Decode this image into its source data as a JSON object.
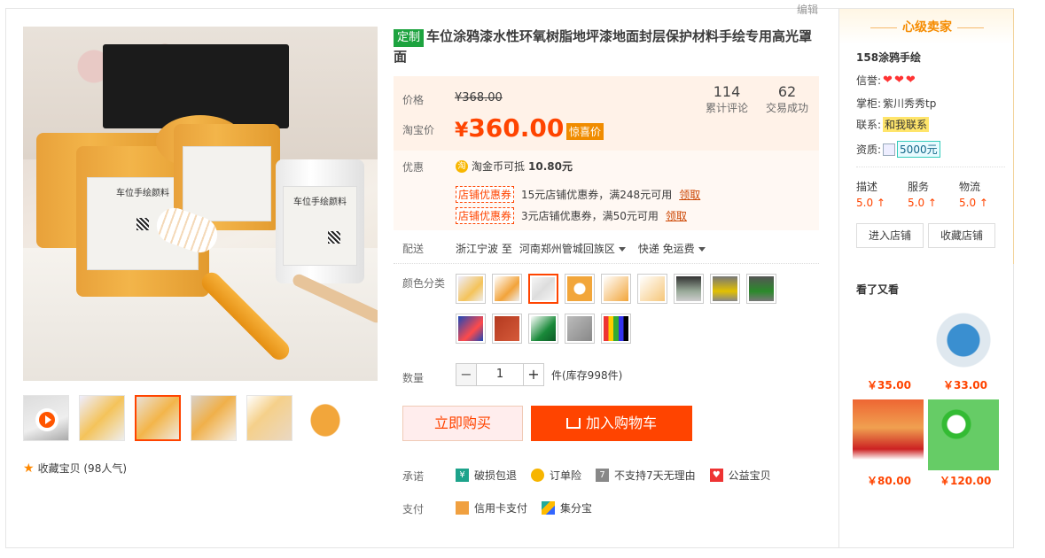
{
  "edit_link": "编辑",
  "product": {
    "tag": "定制",
    "title": "车位涂鸦漆水性环氧树脂地坪漆地面封层保护材料手绘专用高光罩面"
  },
  "gallery": {
    "jar_label": "车位手绘颜料",
    "favorite": "收藏宝贝 (98人气)"
  },
  "price": {
    "label": "价格",
    "original": "¥368.00",
    "taobao_label": "淘宝价",
    "currency": "¥",
    "current": "360.00",
    "surprise_tag": "惊喜价",
    "stats": [
      {
        "value": "114",
        "label": "累计评论"
      },
      {
        "value": "62",
        "label": "交易成功"
      }
    ]
  },
  "promo": {
    "label": "优惠",
    "coin_icon_text": "淘",
    "coin_text_prefix": "淘金币可抵",
    "coin_amount": "10.80元",
    "coupons": [
      {
        "tag": "店铺优惠券",
        "desc": "15元店铺优惠券，满248元可用",
        "action": "领取"
      },
      {
        "tag": "店铺优惠券",
        "desc": "3元店铺优惠券，满50元可用",
        "action": "领取"
      }
    ]
  },
  "shipping": {
    "label": "配送",
    "from": "浙江宁波 至",
    "to": "河南郑州管城回族区",
    "method": "快递 免运费"
  },
  "color": {
    "label": "颜色分类"
  },
  "quantity": {
    "label": "数量",
    "minus": "−",
    "plus": "+",
    "value": "1",
    "stock": "件(库存998件)"
  },
  "buttons": {
    "buy_now": "立即购买",
    "add_cart": "加入购物车"
  },
  "promise": {
    "label": "承诺",
    "items": [
      {
        "icon_text": "¥",
        "text": "破损包退",
        "color": "#1da38b"
      },
      {
        "icon_text": "",
        "text": "订单险",
        "color": "#f7b500"
      },
      {
        "icon_text": "7",
        "text": "不支持7天无理由",
        "color": "#888888"
      },
      {
        "icon_text": "♥",
        "text": "公益宝贝",
        "color": "#e33"
      }
    ]
  },
  "payment": {
    "label": "支付",
    "items": [
      "信用卡支付",
      "集分宝"
    ]
  },
  "seller": {
    "header": "心级卖家",
    "shop_name": "158涂鸦手绘",
    "credit_label": "信誉:",
    "keeper_label": "掌柜:",
    "keeper": "紫川秀秀tp",
    "contact_label": "联系:",
    "contact_btn": "和我联系",
    "qual_label": "资质:",
    "deposit": "5000元",
    "ratings": [
      {
        "label": "描述",
        "value": "5.0"
      },
      {
        "label": "服务",
        "value": "5.0"
      },
      {
        "label": "物流",
        "value": "5.0"
      }
    ],
    "enter_shop": "进入店铺",
    "fav_shop": "收藏店铺"
  },
  "also_viewed": {
    "title": "看了又看",
    "items": [
      {
        "price": "￥35.00"
      },
      {
        "price": "￥33.00"
      },
      {
        "price": "￥80.00"
      },
      {
        "price": "￥120.00"
      }
    ]
  },
  "colors": {
    "accent": "#ff4400",
    "price": "#ff4400",
    "tag_green": "#1da33f"
  }
}
